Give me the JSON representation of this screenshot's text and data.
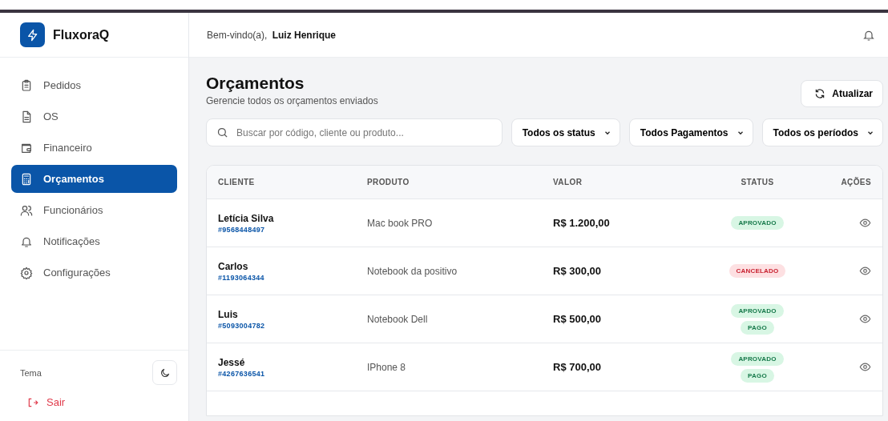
{
  "sidebar": {
    "logo": "FluxoraQ",
    "items": [
      {
        "label": "Pedidos",
        "selected": false
      },
      {
        "label": "OS",
        "selected": false
      },
      {
        "label": "Financeiro",
        "selected": false
      },
      {
        "label": "Orçamentos",
        "selected": true
      },
      {
        "label": "Funcionários",
        "selected": false
      },
      {
        "label": "Notificações",
        "selected": false
      },
      {
        "label": "Configurações",
        "selected": false
      }
    ],
    "theme_label": "Tema",
    "logout": "Sair"
  },
  "header": {
    "greeting": "Bem-vindo(a),",
    "user": "Luiz Henrique"
  },
  "page": {
    "title": "Orçamentos",
    "subtitle": "Gerencie todos os orçamentos enviados",
    "refresh": "Atualizar"
  },
  "search": {
    "placeholder": "Buscar por código, cliente ou produto..."
  },
  "filters": [
    "Todos os status",
    "Todos Pagamentos",
    "Todos os períodos"
  ],
  "table": {
    "columns": [
      "CLIENTE",
      "PRODUTO",
      "VALOR",
      "STATUS",
      "AÇÕES"
    ],
    "rows": [
      {
        "client": "Letícia Silva",
        "code": "#9568448497",
        "product": "Mac book PRO",
        "value": "R$ 1.200,00",
        "badges": [
          {
            "label": "APROVADO",
            "kind": "approved"
          }
        ]
      },
      {
        "client": "Carlos",
        "code": "#1193064344",
        "product": "Notebook da positivo",
        "value": "R$ 300,00",
        "badges": [
          {
            "label": "CANCELADO",
            "kind": "cancelled"
          }
        ]
      },
      {
        "client": "Luis",
        "code": "#5093004782",
        "product": "Notebook Dell",
        "value": "R$ 500,00",
        "badges": [
          {
            "label": "APROVADO",
            "kind": "approved"
          },
          {
            "label": "PAGO",
            "kind": "paid"
          }
        ]
      },
      {
        "client": "Jessé",
        "code": "#4267636541",
        "product": "IPhone 8",
        "value": "R$ 700,00",
        "badges": [
          {
            "label": "APROVADO",
            "kind": "approved"
          },
          {
            "label": "PAGO",
            "kind": "paid"
          }
        ]
      }
    ]
  }
}
